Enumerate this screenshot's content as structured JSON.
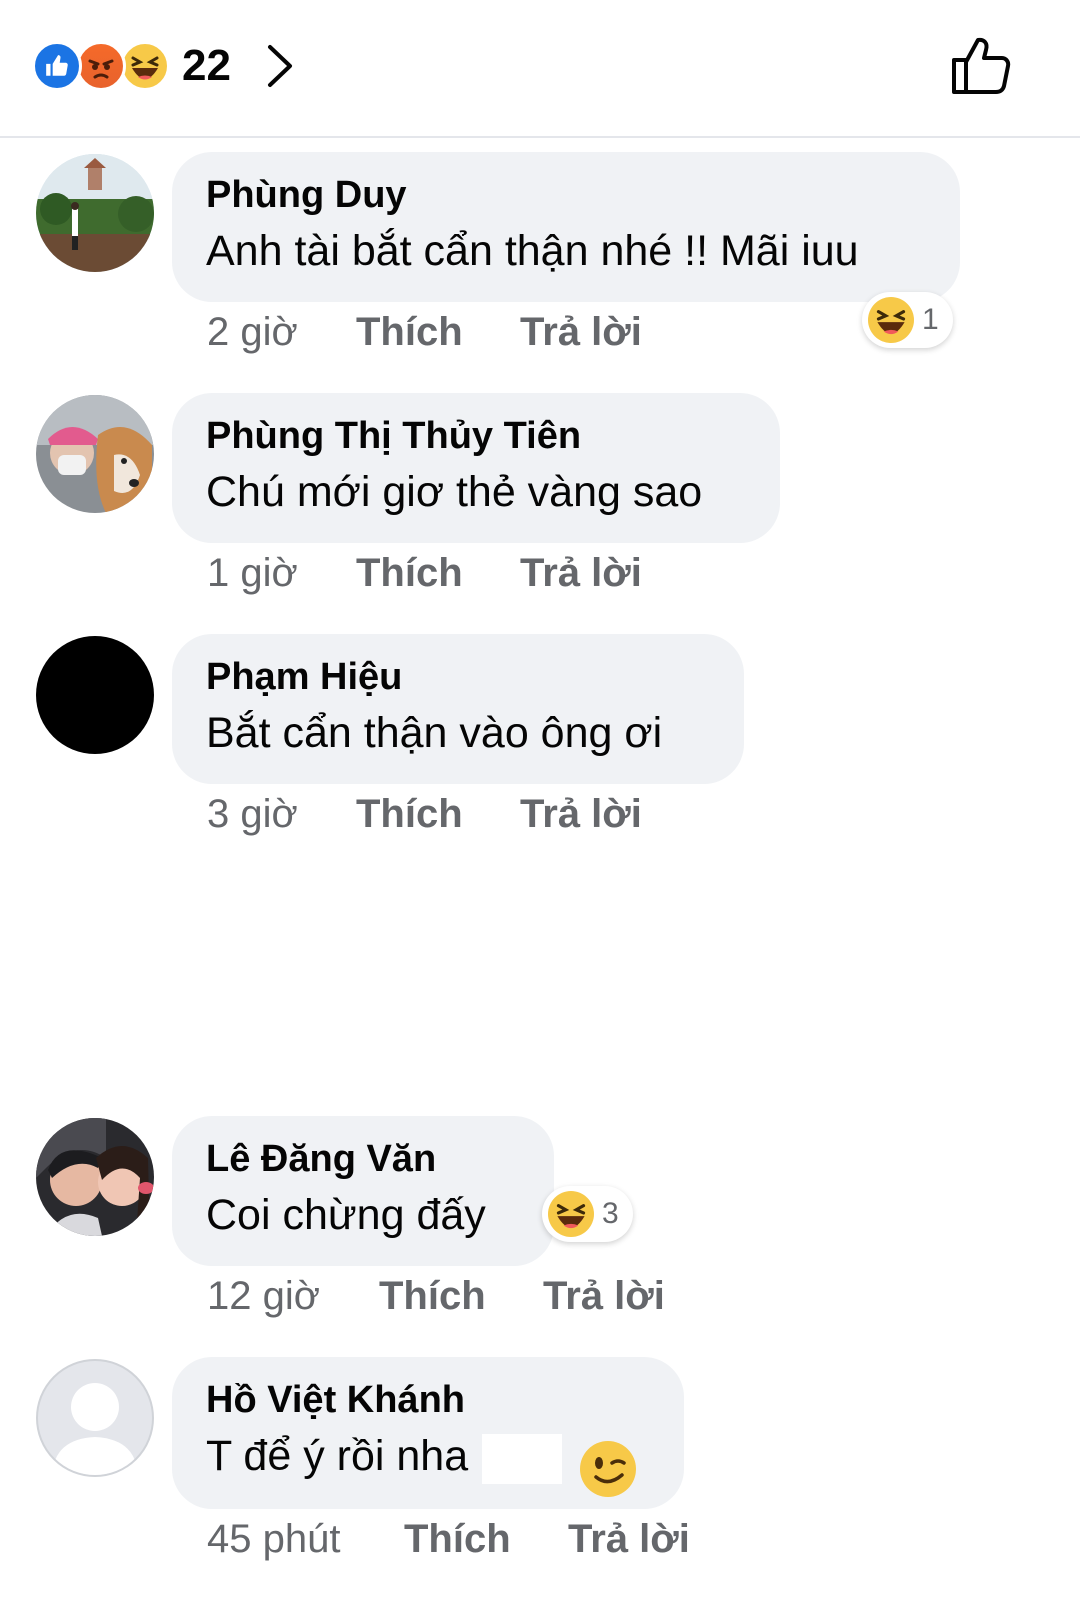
{
  "header": {
    "reaction_count": "22",
    "reaction_icons": [
      "like-icon",
      "angry-icon",
      "haha-icon"
    ],
    "like_button_icon": "thumbs-up-outline-icon"
  },
  "actions": {
    "like_label": "Thích",
    "reply_label": "Trả lời"
  },
  "comments": [
    {
      "author": "Phùng Duy",
      "text": "Anh tài bắt cẩn thận nhé !! Mãi iuu",
      "time": "2 giờ",
      "reaction_count": "1",
      "reaction_icon": "haha-icon"
    },
    {
      "author": "Phùng Thị Thủy Tiên",
      "text": "Chú mới giơ thẻ vàng sao",
      "time": "1 giờ"
    },
    {
      "author": "Phạm Hiệu",
      "text": "Bắt cẩn thận vào ông ơi",
      "time": "3 giờ"
    },
    {
      "author": "Lê Đăng Văn",
      "text": "Coi chừng đấy",
      "time": "12 giờ",
      "reaction_count": "3",
      "reaction_icon": "haha-icon"
    },
    {
      "author": "Hồ Việt Khánh",
      "text": "T để ý rồi nha",
      "time": "45 phút",
      "emoji_icon": "wink-emoji-icon"
    }
  ],
  "colors": {
    "bubble": "#f0f2f5",
    "meta_text": "#65676b",
    "like_blue": "#1b74e4",
    "haha_yellow": "#f7c948"
  }
}
